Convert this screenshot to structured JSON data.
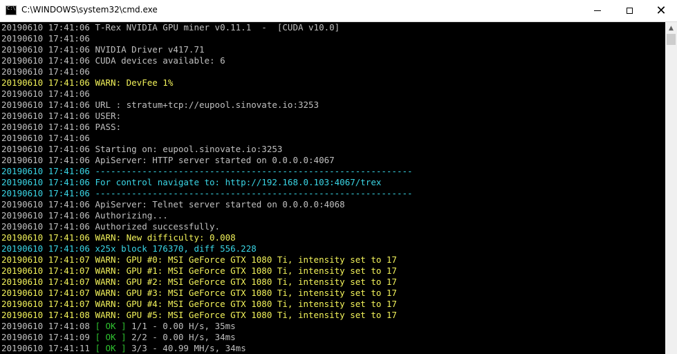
{
  "window": {
    "title": "C:\\WINDOWS\\system32\\cmd.exe",
    "buttons": [
      "minimize",
      "maximize",
      "close"
    ]
  },
  "colors": {
    "default_text": "#c0c0c0",
    "warn": "#f2f25a",
    "info": "#3ad6e6",
    "ok": "#2fc22f",
    "background": "#000000"
  },
  "console": {
    "lines": [
      {
        "ts": "20190610 17:41:06",
        "msg": "T-Rex NVIDIA GPU miner v0.11.1  -  [CUDA v10.0]",
        "color": "default"
      },
      {
        "ts": "20190610 17:41:06",
        "msg": "",
        "color": "default"
      },
      {
        "ts": "20190610 17:41:06",
        "msg": "NVIDIA Driver v417.71",
        "color": "default"
      },
      {
        "ts": "20190610 17:41:06",
        "msg": "CUDA devices available: 6",
        "color": "default"
      },
      {
        "ts": "20190610 17:41:06",
        "msg": "",
        "color": "default"
      },
      {
        "ts": "20190610 17:41:06",
        "msg": "WARN: DevFee 1%",
        "color": "yellow"
      },
      {
        "ts": "20190610 17:41:06",
        "msg": "",
        "color": "default"
      },
      {
        "ts": "20190610 17:41:06",
        "msg": "URL : stratum+tcp://eupool.sinovate.io:3253",
        "color": "default"
      },
      {
        "ts": "20190610 17:41:06",
        "msg": "USER:",
        "color": "default"
      },
      {
        "ts": "20190610 17:41:06",
        "msg": "PASS:",
        "color": "default"
      },
      {
        "ts": "20190610 17:41:06",
        "msg": "",
        "color": "default"
      },
      {
        "ts": "20190610 17:41:06",
        "msg": "Starting on: eupool.sinovate.io:3253",
        "color": "default"
      },
      {
        "ts": "20190610 17:41:06",
        "msg": "ApiServer: HTTP server started on 0.0.0.0:4067",
        "color": "default"
      },
      {
        "ts": "20190610 17:41:06",
        "msg": "-------------------------------------------------------------",
        "color": "cyan"
      },
      {
        "ts": "20190610 17:41:06",
        "msg": "For control navigate to: http://192.168.0.103:4067/trex",
        "color": "cyan"
      },
      {
        "ts": "20190610 17:41:06",
        "msg": "-------------------------------------------------------------",
        "color": "cyan"
      },
      {
        "ts": "20190610 17:41:06",
        "msg": "ApiServer: Telnet server started on 0.0.0.0:4068",
        "color": "default"
      },
      {
        "ts": "20190610 17:41:06",
        "msg": "Authorizing...",
        "color": "default"
      },
      {
        "ts": "20190610 17:41:06",
        "msg": "Authorized successfully.",
        "color": "default"
      },
      {
        "ts": "20190610 17:41:06",
        "msg": "WARN: New difficulty: 0.008",
        "color": "yellow"
      },
      {
        "ts": "20190610 17:41:06",
        "msg": "x25x block 176370, diff 556.228",
        "color": "cyan"
      },
      {
        "ts": "20190610 17:41:07",
        "msg": "WARN: GPU #0: MSI GeForce GTX 1080 Ti, intensity set to 17",
        "color": "yellow"
      },
      {
        "ts": "20190610 17:41:07",
        "msg": "WARN: GPU #1: MSI GeForce GTX 1080 Ti, intensity set to 17",
        "color": "yellow"
      },
      {
        "ts": "20190610 17:41:07",
        "msg": "WARN: GPU #2: MSI GeForce GTX 1080 Ti, intensity set to 17",
        "color": "yellow"
      },
      {
        "ts": "20190610 17:41:07",
        "msg": "WARN: GPU #3: MSI GeForce GTX 1080 Ti, intensity set to 17",
        "color": "yellow"
      },
      {
        "ts": "20190610 17:41:07",
        "msg": "WARN: GPU #4: MSI GeForce GTX 1080 Ti, intensity set to 17",
        "color": "yellow"
      },
      {
        "ts": "20190610 17:41:08",
        "msg": "WARN: GPU #5: MSI GeForce GTX 1080 Ti, intensity set to 17",
        "color": "yellow"
      },
      {
        "ts": "20190610 17:41:08",
        "ok": "[ OK ]",
        "msg": "1/1 - 0.00 H/s, 35ms",
        "color": "default"
      },
      {
        "ts": "20190610 17:41:09",
        "ok": "[ OK ]",
        "msg": "2/2 - 0.00 H/s, 34ms",
        "color": "default"
      },
      {
        "ts": "20190610 17:41:11",
        "ok": "[ OK ]",
        "msg": "3/3 - 40.99 MH/s, 34ms",
        "color": "default"
      }
    ]
  }
}
